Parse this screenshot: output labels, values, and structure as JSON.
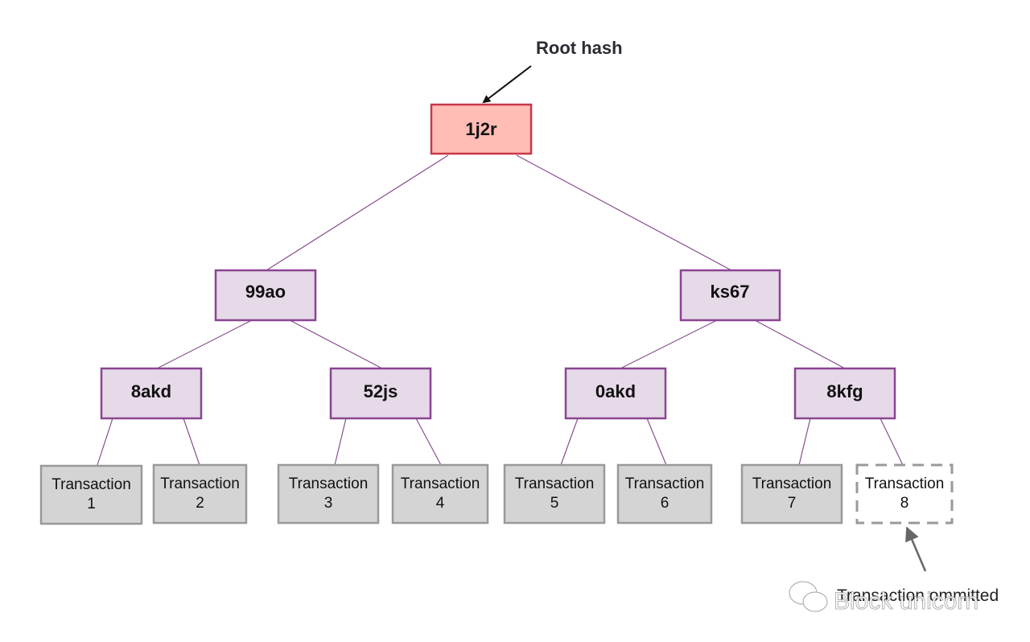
{
  "root_label": "Root hash",
  "nodes": {
    "root": "1j2r",
    "l1": [
      "99ao",
      "ks67"
    ],
    "l2": [
      "8akd",
      "52js",
      "0akd",
      "8kfg"
    ]
  },
  "transactions": [
    {
      "word": "Transaction",
      "num": "1"
    },
    {
      "word": "Transaction",
      "num": "2"
    },
    {
      "word": "Transaction",
      "num": "3"
    },
    {
      "word": "Transaction",
      "num": "4"
    },
    {
      "word": "Transaction",
      "num": "5"
    },
    {
      "word": "Transaction",
      "num": "6"
    },
    {
      "word": "Transaction",
      "num": "7"
    },
    {
      "word": "Transaction",
      "num": "8",
      "omitted": true
    }
  ],
  "omitted_label": "Transaction ommitted",
  "watermark": "Block unicorn",
  "colors": {
    "root_fill": "#ffbdb5",
    "root_stroke": "#c9374a",
    "node_fill": "#e6d9e8",
    "node_stroke": "#8a4592",
    "tx_fill": "#d4d4d4",
    "tx_stroke": "#999999",
    "edge": "#8a4f8f"
  }
}
